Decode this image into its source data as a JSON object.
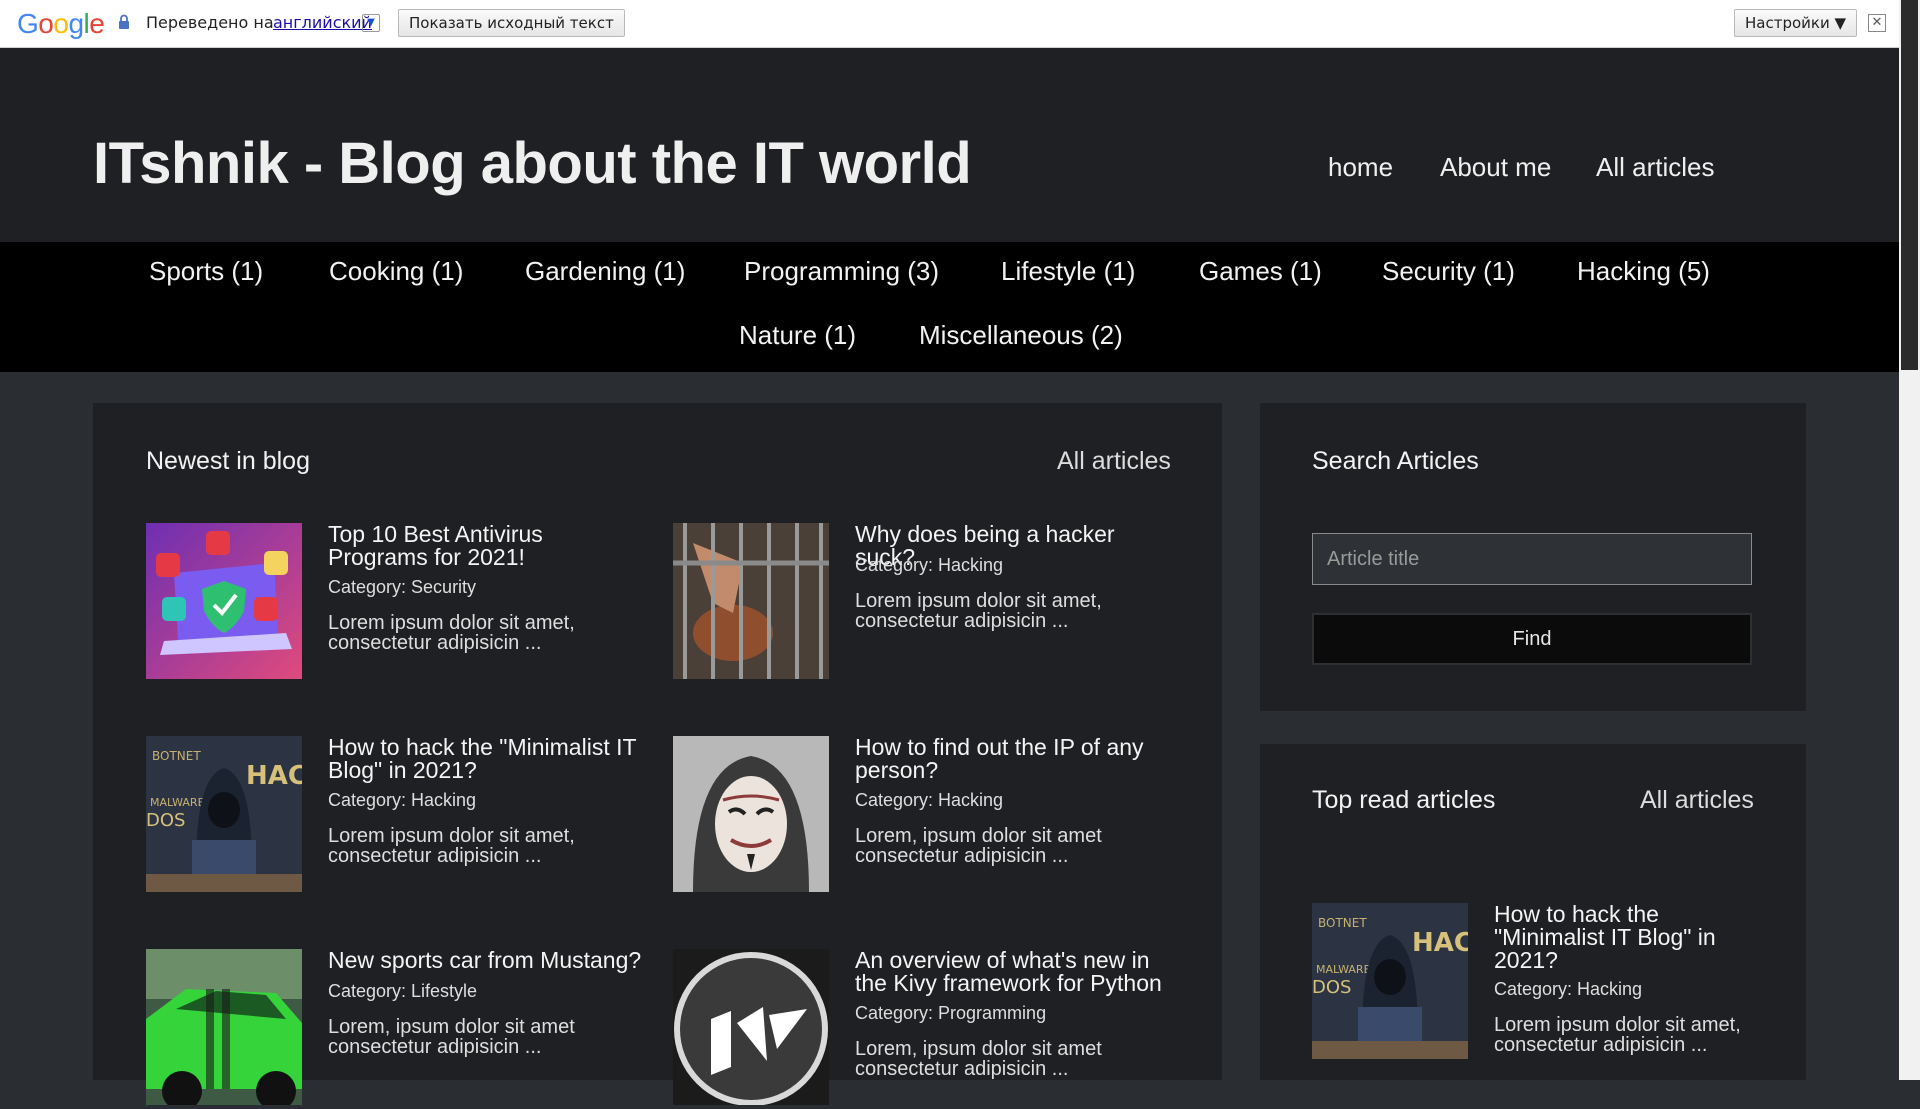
{
  "translate_bar": {
    "logo": "Google",
    "translated_to": "Переведено на",
    "language": "английский",
    "show_original": "Показать исходный текст",
    "settings": "Настройки ▼",
    "close": "✕"
  },
  "header": {
    "title": "ITshnik - Blog about the IT world",
    "nav": {
      "home": "home",
      "about": "About me",
      "all": "All articles"
    }
  },
  "categories": [
    "Sports (1)",
    "Cooking (1)",
    "Gardening (1)",
    "Programming (3)",
    "Lifestyle (1)",
    "Games (1)",
    "Security (1)",
    "Hacking (5)",
    "Nature (1)",
    "Miscellaneous (2)"
  ],
  "newest": {
    "heading": "Newest in blog",
    "all_link": "All articles",
    "articles": [
      {
        "title": "Top 10 Best Antivirus Programs for 2021!",
        "category": "Category: Security",
        "excerpt": "Lorem ipsum dolor sit amet, consectetur adipisicin ...",
        "image": "antivirus-laptop-image"
      },
      {
        "title": "Why does being a hacker suck?",
        "category": "Category: Hacking",
        "excerpt": "Lorem ipsum dolor sit amet, consectetur adipisicin ...",
        "image": "prison-bars-image"
      },
      {
        "title": "How to hack the \"Minimalist IT Blog\" in 2021?",
        "category": "Category: Hacking",
        "excerpt": "Lorem ipsum dolor sit amet, consectetur adipisicin ...",
        "image": "hooded-hacker-image"
      },
      {
        "title": "How to find out the IP of any person?",
        "category": "Category: Hacking",
        "excerpt": "Lorem, ipsum dolor sit amet consectetur adipisicin ...",
        "image": "guy-fawkes-mask-image"
      },
      {
        "title": "New sports car from Mustang?",
        "category": "Category: Lifestyle",
        "excerpt": "Lorem, ipsum dolor sit amet consectetur adipisicin ...",
        "image": "green-mustang-image"
      },
      {
        "title": "An overview of what's new in the Kivy framework for Python",
        "category": "Category: Programming",
        "excerpt": "Lorem, ipsum dolor sit amet consectetur adipisicin ...",
        "image": "kivy-logo-image"
      }
    ]
  },
  "search": {
    "heading": "Search Articles",
    "placeholder": "Article title",
    "button": "Find"
  },
  "top_read": {
    "heading": "Top read articles",
    "all_link": "All articles",
    "article": {
      "title": "How to hack the \"Minimalist IT Blog\" in 2021?",
      "category": "Category: Hacking",
      "excerpt": "Lorem ipsum dolor sit amet, consectetur adipisicin ...",
      "image": "hooded-hacker-image"
    }
  }
}
